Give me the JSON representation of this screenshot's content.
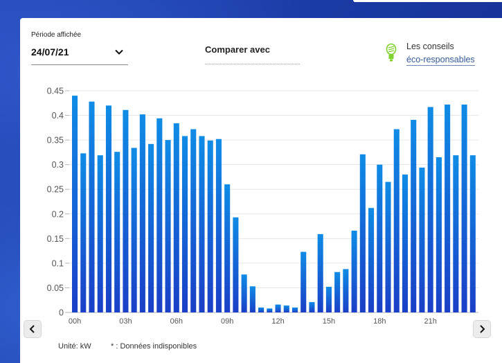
{
  "header": {
    "period_label": "Période affichée",
    "period_value": "24/07/21",
    "compare_label": "Comparer avec",
    "tips_line1": "Les conseils",
    "tips_line2": "éco-responsables"
  },
  "footer": {
    "unit_label": "Unité: kW",
    "note_label": "* : Données indisponibles"
  },
  "icons": {
    "period_dropdown": "chevron-down-icon",
    "tips": "lightbulb-icon",
    "nav_prev": "chevron-left-icon",
    "nav_next": "chevron-right-icon"
  },
  "colors": {
    "bar_top": "#0f8ce6",
    "bar_bottom": "#1a3fc7",
    "bulb": "#7fd12b"
  },
  "chart_data": {
    "type": "bar",
    "ylim": [
      0,
      0.45
    ],
    "yticks": [
      "0",
      "0.05",
      "0.1",
      "0.15",
      "0.2",
      "0.25",
      "0.3",
      "0.35",
      "0.4",
      "0.45"
    ],
    "xtick_labels": [
      "00h",
      "03h",
      "06h",
      "09h",
      "12h",
      "15h",
      "18h",
      "21h"
    ],
    "grid": true,
    "values": [
      0.44,
      0.323,
      0.428,
      0.319,
      0.42,
      0.326,
      0.411,
      0.334,
      0.402,
      0.342,
      0.394,
      0.35,
      0.384,
      0.358,
      0.372,
      0.358,
      0.349,
      0.352,
      0.26,
      0.193,
      0.077,
      0.053,
      0.01,
      0.008,
      0.016,
      0.014,
      0.01,
      0.123,
      0.021,
      0.159,
      0.052,
      0.082,
      0.088,
      0.166,
      0.321,
      0.212,
      0.3,
      0.265,
      0.372,
      0.28,
      0.391,
      0.294,
      0.417,
      0.315,
      0.422,
      0.319,
      0.422,
      0.319
    ]
  }
}
